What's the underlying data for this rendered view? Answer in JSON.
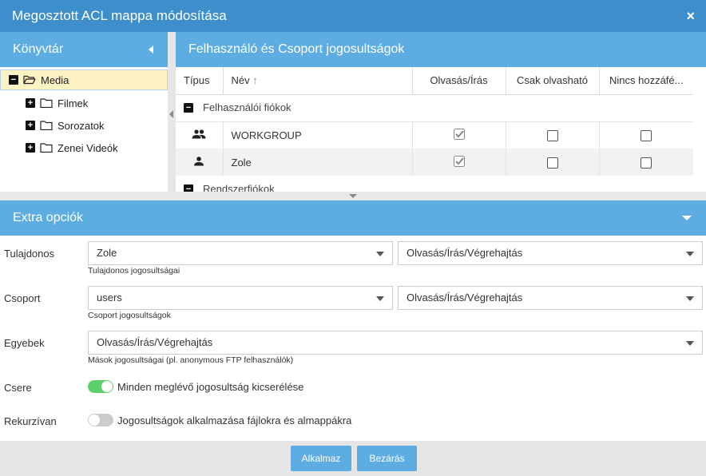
{
  "dialog": {
    "title": "Megosztott ACL mappa módosítása",
    "close_icon": "×"
  },
  "library": {
    "header": "Könyvtár",
    "root": {
      "label": "Media",
      "expander": "−"
    },
    "children": [
      {
        "label": "Filmek",
        "expander": "+"
      },
      {
        "label": "Sorozatok",
        "expander": "+"
      },
      {
        "label": "Zenei Videók",
        "expander": "+"
      }
    ]
  },
  "permissions": {
    "header": "Felhasználó és Csoport jogosultságok",
    "columns": [
      "Típus",
      "Név",
      "Olvasás/Írás",
      "Csak olvasható",
      "Nincs hozzáfé..."
    ],
    "sort_icon": "↑",
    "groups": [
      {
        "label": "Felhasználói fiókok",
        "expander": "−",
        "rows": [
          {
            "type_icon": "group-icon",
            "name": "WORKGROUP",
            "rw": true,
            "ro": false,
            "none": false
          },
          {
            "type_icon": "user-icon",
            "name": "Zole",
            "rw": true,
            "ro": false,
            "none": false
          }
        ]
      },
      {
        "label": "Rendszerfiókok",
        "expander": "−",
        "rows": []
      }
    ]
  },
  "extra": {
    "header": "Extra opciók",
    "owner": {
      "label": "Tulajdonos",
      "value": "Zole",
      "perm": "Olvasás/Írás/Végrehajtás",
      "hint": "Tulajdonos jogosultságai"
    },
    "group": {
      "label": "Csoport",
      "value": "users",
      "perm": "Olvasás/Írás/Végrehajtás",
      "hint": "Csoport jogosultságok"
    },
    "others": {
      "label": "Egyebek",
      "perm": "Olvasás/Írás/Végrehajtás",
      "hint": "Mások jogosultságai (pl. anonymous FTP felhasználók)"
    },
    "replace": {
      "label": "Csere",
      "toggle_label": "Minden meglévő jogosultság kicserélése",
      "on": true
    },
    "recursive": {
      "label": "Rekurzívan",
      "toggle_label": "Jogosultságok alkalmazása fájlokra és almappákra",
      "on": false
    }
  },
  "buttons": {
    "apply": "Alkalmaz",
    "close": "Bezárás"
  },
  "colors": {
    "titlebar": "#3d8ecb",
    "header": "#5dade2",
    "toggle_on": "#5cd16a",
    "selected": "#fdf2c4"
  }
}
